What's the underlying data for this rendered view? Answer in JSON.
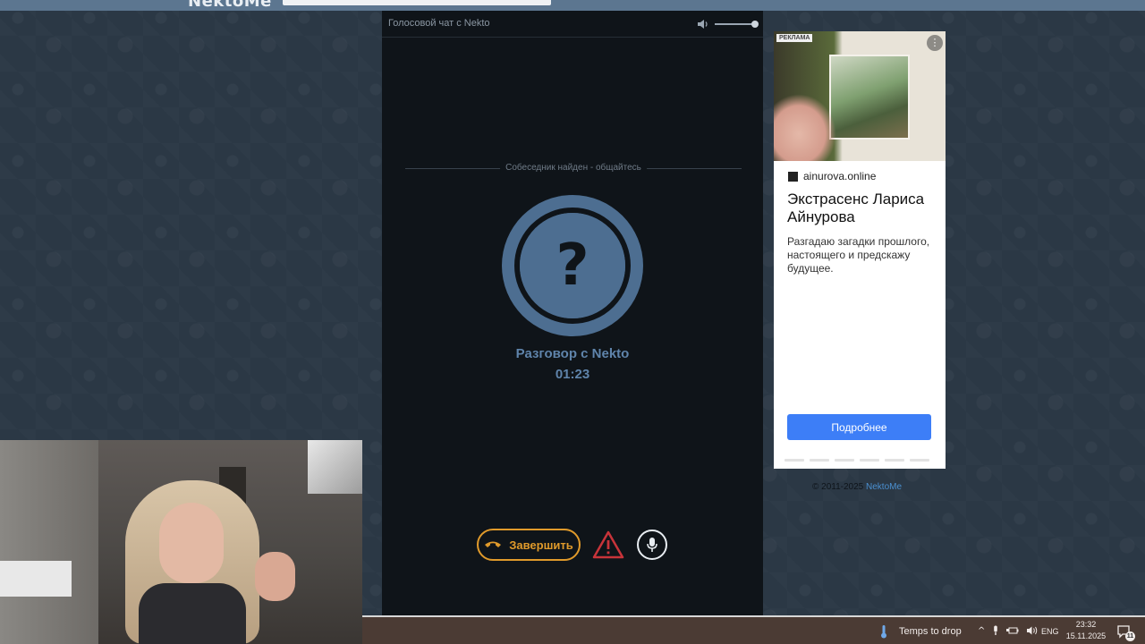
{
  "site": {
    "logo": "NektoMe"
  },
  "chat": {
    "title": "Голосовой чат с Nekto",
    "status": "Собеседник найден - общайтесь",
    "partner": "Разговор с Nekto",
    "timer": "01:23",
    "end_label": "Завершить",
    "volume_level": 1.0
  },
  "icons": {
    "volume": "speaker-icon",
    "end": "phone-hangup-icon",
    "report": "warning-triangle-icon",
    "mic": "microphone-icon",
    "avatar": "question-mark-icon"
  },
  "ad": {
    "label": "РЕКЛАМА",
    "more": "⋮",
    "domain": "ainurova.online",
    "headline": "Экстрасенс Лариса Айнурова",
    "description": "Разгадаю загадки прошлого, настоящего и предскажу будущее.",
    "cta": "Подробнее"
  },
  "footer": {
    "copyright": "© 2011-2025",
    "link": "NektoMe"
  },
  "taskbar": {
    "weather": "Temps to drop",
    "tray_caret": "^",
    "lang": "ENG",
    "time": "23:32",
    "date": "15.11.2025",
    "notifications": "11"
  },
  "colors": {
    "accent_orange": "#e09a2b",
    "avatar_blue": "#4d6e91",
    "report_red": "#c8343a",
    "ad_button": "#3d7ef7"
  }
}
